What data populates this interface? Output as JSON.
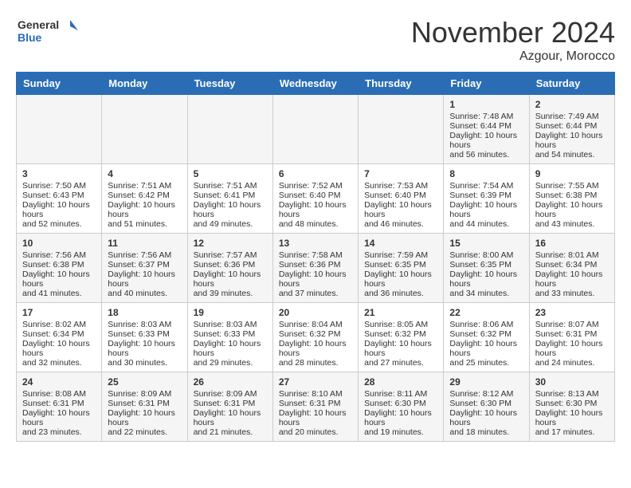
{
  "header": {
    "logo_line1": "General",
    "logo_line2": "Blue",
    "month": "November 2024",
    "location": "Azgour, Morocco"
  },
  "weekdays": [
    "Sunday",
    "Monday",
    "Tuesday",
    "Wednesday",
    "Thursday",
    "Friday",
    "Saturday"
  ],
  "weeks": [
    [
      {
        "day": "",
        "info": ""
      },
      {
        "day": "",
        "info": ""
      },
      {
        "day": "",
        "info": ""
      },
      {
        "day": "",
        "info": ""
      },
      {
        "day": "",
        "info": ""
      },
      {
        "day": "1",
        "info": "Sunrise: 7:48 AM\nSunset: 6:44 PM\nDaylight: 10 hours and 56 minutes."
      },
      {
        "day": "2",
        "info": "Sunrise: 7:49 AM\nSunset: 6:44 PM\nDaylight: 10 hours and 54 minutes."
      }
    ],
    [
      {
        "day": "3",
        "info": "Sunrise: 7:50 AM\nSunset: 6:43 PM\nDaylight: 10 hours and 52 minutes."
      },
      {
        "day": "4",
        "info": "Sunrise: 7:51 AM\nSunset: 6:42 PM\nDaylight: 10 hours and 51 minutes."
      },
      {
        "day": "5",
        "info": "Sunrise: 7:51 AM\nSunset: 6:41 PM\nDaylight: 10 hours and 49 minutes."
      },
      {
        "day": "6",
        "info": "Sunrise: 7:52 AM\nSunset: 6:40 PM\nDaylight: 10 hours and 48 minutes."
      },
      {
        "day": "7",
        "info": "Sunrise: 7:53 AM\nSunset: 6:40 PM\nDaylight: 10 hours and 46 minutes."
      },
      {
        "day": "8",
        "info": "Sunrise: 7:54 AM\nSunset: 6:39 PM\nDaylight: 10 hours and 44 minutes."
      },
      {
        "day": "9",
        "info": "Sunrise: 7:55 AM\nSunset: 6:38 PM\nDaylight: 10 hours and 43 minutes."
      }
    ],
    [
      {
        "day": "10",
        "info": "Sunrise: 7:56 AM\nSunset: 6:38 PM\nDaylight: 10 hours and 41 minutes."
      },
      {
        "day": "11",
        "info": "Sunrise: 7:56 AM\nSunset: 6:37 PM\nDaylight: 10 hours and 40 minutes."
      },
      {
        "day": "12",
        "info": "Sunrise: 7:57 AM\nSunset: 6:36 PM\nDaylight: 10 hours and 39 minutes."
      },
      {
        "day": "13",
        "info": "Sunrise: 7:58 AM\nSunset: 6:36 PM\nDaylight: 10 hours and 37 minutes."
      },
      {
        "day": "14",
        "info": "Sunrise: 7:59 AM\nSunset: 6:35 PM\nDaylight: 10 hours and 36 minutes."
      },
      {
        "day": "15",
        "info": "Sunrise: 8:00 AM\nSunset: 6:35 PM\nDaylight: 10 hours and 34 minutes."
      },
      {
        "day": "16",
        "info": "Sunrise: 8:01 AM\nSunset: 6:34 PM\nDaylight: 10 hours and 33 minutes."
      }
    ],
    [
      {
        "day": "17",
        "info": "Sunrise: 8:02 AM\nSunset: 6:34 PM\nDaylight: 10 hours and 32 minutes."
      },
      {
        "day": "18",
        "info": "Sunrise: 8:03 AM\nSunset: 6:33 PM\nDaylight: 10 hours and 30 minutes."
      },
      {
        "day": "19",
        "info": "Sunrise: 8:03 AM\nSunset: 6:33 PM\nDaylight: 10 hours and 29 minutes."
      },
      {
        "day": "20",
        "info": "Sunrise: 8:04 AM\nSunset: 6:32 PM\nDaylight: 10 hours and 28 minutes."
      },
      {
        "day": "21",
        "info": "Sunrise: 8:05 AM\nSunset: 6:32 PM\nDaylight: 10 hours and 27 minutes."
      },
      {
        "day": "22",
        "info": "Sunrise: 8:06 AM\nSunset: 6:32 PM\nDaylight: 10 hours and 25 minutes."
      },
      {
        "day": "23",
        "info": "Sunrise: 8:07 AM\nSunset: 6:31 PM\nDaylight: 10 hours and 24 minutes."
      }
    ],
    [
      {
        "day": "24",
        "info": "Sunrise: 8:08 AM\nSunset: 6:31 PM\nDaylight: 10 hours and 23 minutes."
      },
      {
        "day": "25",
        "info": "Sunrise: 8:09 AM\nSunset: 6:31 PM\nDaylight: 10 hours and 22 minutes."
      },
      {
        "day": "26",
        "info": "Sunrise: 8:09 AM\nSunset: 6:31 PM\nDaylight: 10 hours and 21 minutes."
      },
      {
        "day": "27",
        "info": "Sunrise: 8:10 AM\nSunset: 6:31 PM\nDaylight: 10 hours and 20 minutes."
      },
      {
        "day": "28",
        "info": "Sunrise: 8:11 AM\nSunset: 6:30 PM\nDaylight: 10 hours and 19 minutes."
      },
      {
        "day": "29",
        "info": "Sunrise: 8:12 AM\nSunset: 6:30 PM\nDaylight: 10 hours and 18 minutes."
      },
      {
        "day": "30",
        "info": "Sunrise: 8:13 AM\nSunset: 6:30 PM\nDaylight: 10 hours and 17 minutes."
      }
    ]
  ]
}
